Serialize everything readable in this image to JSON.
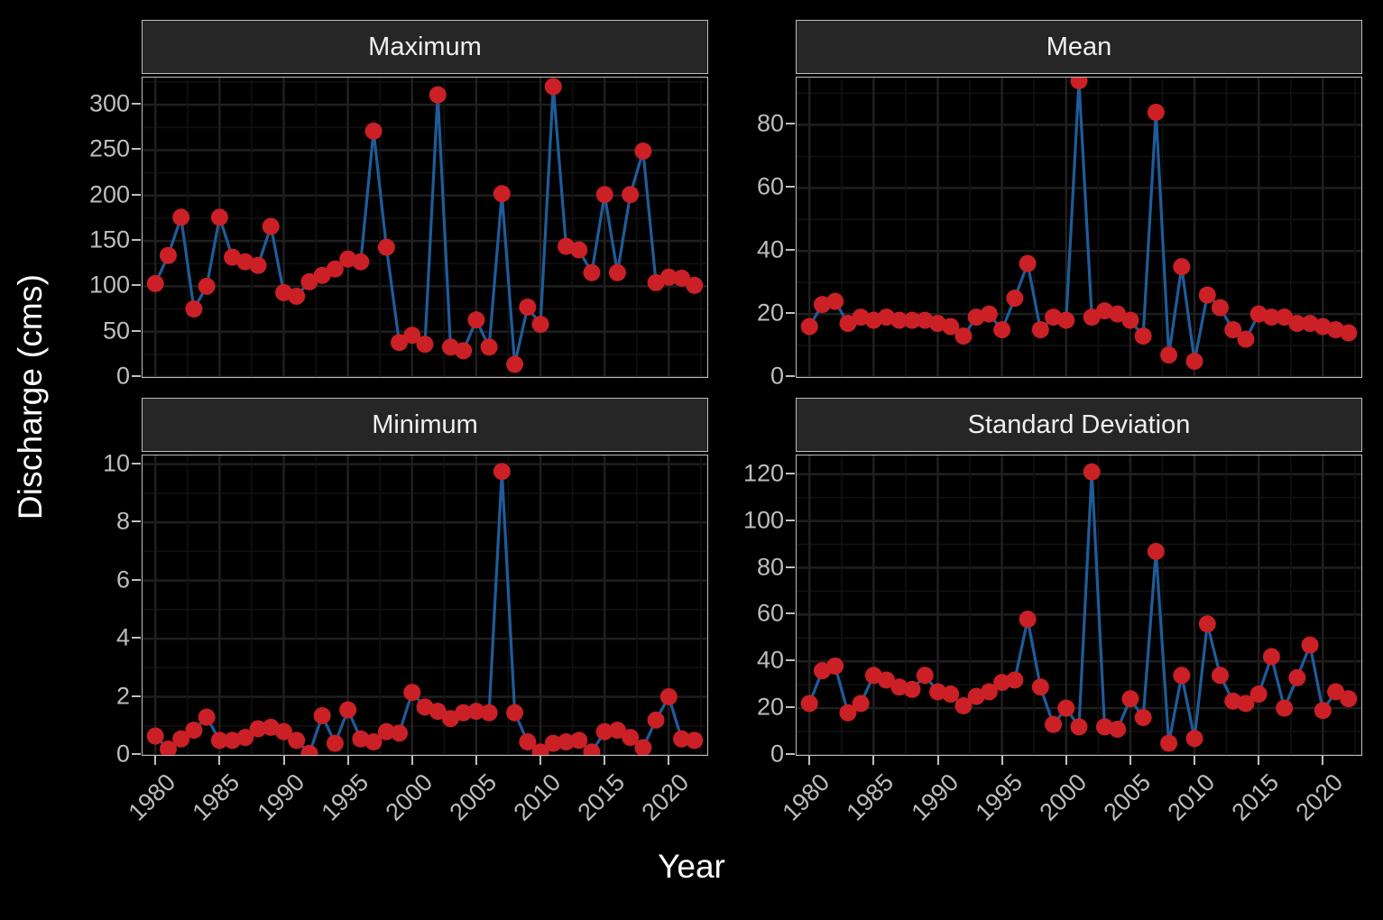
{
  "axis": {
    "y_title": "Discharge (cms)",
    "x_title": "Year"
  },
  "facets": {
    "maximum": "Maximum",
    "mean": "Mean",
    "minimum": "Minimum",
    "sd": "Standard Deviation"
  },
  "colors": {
    "point": "#CB2026",
    "line": "#1F5C99",
    "panel_bg": "#000000",
    "strip_bg": "#262626",
    "grid_major": "#1f1f1f",
    "grid_minor": "#111111",
    "text": "#bdbdbd",
    "title_text": "#ffffff",
    "border": "#bfbfbf"
  },
  "chart_data": [
    {
      "type": "line",
      "title": "Maximum",
      "xlabel": "Year",
      "ylabel": "Discharge (cms)",
      "xlim": [
        1979,
        2023
      ],
      "ylim": [
        0,
        330
      ],
      "xticks": [
        1980,
        1985,
        1990,
        1995,
        2000,
        2005,
        2010,
        2015,
        2020
      ],
      "yticks": [
        0,
        50,
        100,
        150,
        200,
        250,
        300
      ],
      "grid": true,
      "legend": "none",
      "marker": "circle",
      "x": [
        1980,
        1981,
        1982,
        1983,
        1984,
        1985,
        1986,
        1987,
        1988,
        1989,
        1990,
        1991,
        1992,
        1993,
        1994,
        1995,
        1996,
        1997,
        1998,
        1999,
        2000,
        2001,
        2002,
        2003,
        2004,
        2005,
        2006,
        2007,
        2008,
        2009,
        2010,
        2011,
        2012,
        2013,
        2014,
        2015,
        2016,
        2017,
        2018,
        2019,
        2020,
        2021,
        2022
      ],
      "values": [
        103,
        134,
        176,
        75,
        100,
        176,
        132,
        127,
        123,
        166,
        93,
        89,
        105,
        112,
        119,
        130,
        127,
        271,
        143,
        38,
        46,
        36,
        311,
        33,
        29,
        63,
        33,
        202,
        14,
        77,
        58,
        320,
        144,
        140,
        115,
        201,
        115,
        201,
        249,
        104,
        110,
        109,
        101
      ]
    },
    {
      "type": "line",
      "title": "Mean",
      "xlabel": "Year",
      "ylabel": "Discharge (cms)",
      "xlim": [
        1979,
        2023
      ],
      "ylim": [
        0,
        95
      ],
      "xticks": [
        1980,
        1985,
        1990,
        1995,
        2000,
        2005,
        2010,
        2015,
        2020
      ],
      "yticks": [
        0,
        20,
        40,
        60,
        80
      ],
      "grid": true,
      "legend": "none",
      "marker": "circle",
      "x": [
        1980,
        1981,
        1982,
        1983,
        1984,
        1985,
        1986,
        1987,
        1988,
        1989,
        1990,
        1991,
        1992,
        1993,
        1994,
        1995,
        1996,
        1997,
        1998,
        1999,
        2000,
        2001,
        2002,
        2003,
        2004,
        2005,
        2006,
        2007,
        2008,
        2009,
        2010,
        2011,
        2012,
        2013,
        2014,
        2015,
        2016,
        2017,
        2018,
        2019,
        2020,
        2021,
        2022
      ],
      "values": [
        16,
        23,
        24,
        17,
        19,
        18,
        19,
        18,
        18,
        18,
        17,
        16,
        13,
        19,
        20,
        15,
        25,
        36,
        15,
        19,
        18,
        94,
        19,
        21,
        20,
        18,
        13,
        84,
        7,
        35,
        5,
        26,
        22,
        15,
        12,
        20,
        19,
        19,
        17,
        17,
        16,
        15,
        14
      ]
    },
    {
      "type": "line",
      "title": "Minimum",
      "xlabel": "Year",
      "ylabel": "Discharge (cms)",
      "xlim": [
        1979,
        2023
      ],
      "ylim": [
        0,
        10.3
      ],
      "xticks": [
        1980,
        1985,
        1990,
        1995,
        2000,
        2005,
        2010,
        2015,
        2020
      ],
      "yticks": [
        0,
        2,
        4,
        6,
        8,
        10
      ],
      "grid": true,
      "legend": "none",
      "marker": "circle",
      "x": [
        1980,
        1981,
        1982,
        1983,
        1984,
        1985,
        1986,
        1987,
        1988,
        1989,
        1990,
        1991,
        1992,
        1993,
        1994,
        1995,
        1996,
        1997,
        1998,
        1999,
        2000,
        2001,
        2002,
        2003,
        2004,
        2005,
        2006,
        2007,
        2008,
        2009,
        2010,
        2011,
        2012,
        2013,
        2014,
        2015,
        2016,
        2017,
        2018,
        2019,
        2020,
        2021,
        2022
      ],
      "values": [
        0.65,
        0.2,
        0.55,
        0.85,
        1.3,
        0.5,
        0.5,
        0.6,
        0.9,
        0.95,
        0.8,
        0.5,
        0.05,
        1.35,
        0.4,
        1.55,
        0.55,
        0.45,
        0.8,
        0.75,
        2.15,
        1.65,
        1.5,
        1.25,
        1.45,
        1.5,
        1.45,
        9.75,
        1.45,
        0.45,
        0.1,
        0.4,
        0.45,
        0.5,
        0.1,
        0.8,
        0.85,
        0.6,
        0.25,
        1.2,
        2.0,
        0.55,
        0.5
      ]
    },
    {
      "type": "line",
      "title": "Standard Deviation",
      "xlabel": "Year",
      "ylabel": "Discharge (cms)",
      "xlim": [
        1979,
        2023
      ],
      "ylim": [
        0,
        128
      ],
      "xticks": [
        1980,
        1985,
        1990,
        1995,
        2000,
        2005,
        2010,
        2015,
        2020
      ],
      "yticks": [
        0,
        20,
        40,
        60,
        80,
        100,
        120
      ],
      "grid": true,
      "legend": "none",
      "marker": "circle",
      "x": [
        1980,
        1981,
        1982,
        1983,
        1984,
        1985,
        1986,
        1987,
        1988,
        1989,
        1990,
        1991,
        1992,
        1993,
        1994,
        1995,
        1996,
        1997,
        1998,
        1999,
        2000,
        2001,
        2002,
        2003,
        2004,
        2005,
        2006,
        2007,
        2008,
        2009,
        2010,
        2011,
        2012,
        2013,
        2014,
        2015,
        2016,
        2017,
        2018,
        2019,
        2020,
        2021,
        2022
      ],
      "values": [
        22,
        36,
        38,
        18,
        22,
        34,
        32,
        29,
        28,
        34,
        27,
        26,
        21,
        25,
        27,
        31,
        32,
        58,
        29,
        13,
        20,
        12,
        121,
        12,
        11,
        24,
        16,
        87,
        5,
        34,
        7,
        56,
        34,
        23,
        22,
        26,
        42,
        20,
        33,
        47,
        19,
        27,
        24
      ]
    }
  ]
}
